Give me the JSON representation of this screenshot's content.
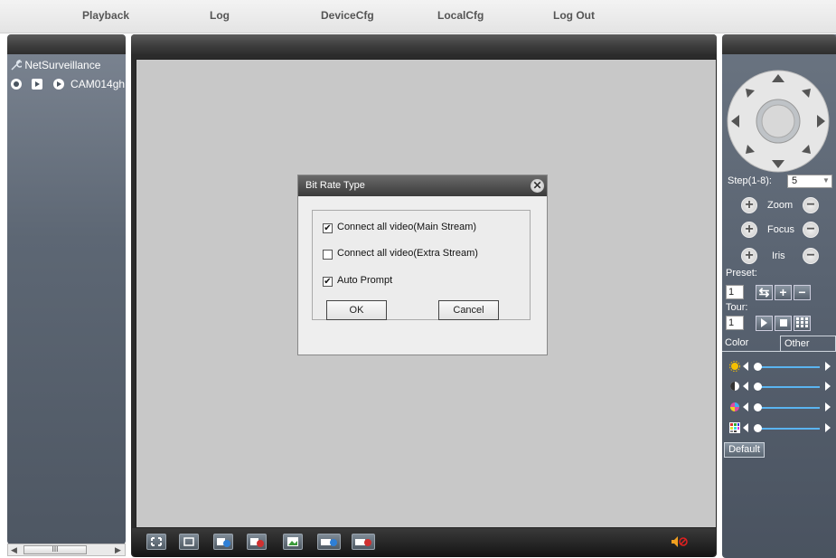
{
  "menu": {
    "items": [
      "Playback",
      "Log",
      "DeviceCfg",
      "LocalCfg",
      "Log Out"
    ]
  },
  "tree": {
    "root_label": "NetSurveillance",
    "camera_label": "CAM014gh"
  },
  "dialog": {
    "title": "Bit Rate Type",
    "options": [
      {
        "label": "Connect all video(Main Stream)",
        "checked": true
      },
      {
        "label": "Connect all video(Extra Stream)",
        "checked": false
      },
      {
        "label": "Auto Prompt",
        "checked": true
      }
    ],
    "ok_label": "OK",
    "cancel_label": "Cancel"
  },
  "ptz": {
    "step_label": "Step(1-8):",
    "step_value": "5",
    "zoom_label": "Zoom",
    "focus_label": "Focus",
    "iris_label": "Iris",
    "preset_label": "Preset:",
    "preset_value": "1",
    "tour_label": "Tour:",
    "tour_value": "1"
  },
  "color_tabs": [
    "Color",
    "Other"
  ],
  "default_label": "Default",
  "scroll_grip": "III",
  "colors": {
    "dialog_bg": "#eeeeee",
    "video_bg": "#c8c8c8",
    "slider": "#5ab4f0"
  }
}
